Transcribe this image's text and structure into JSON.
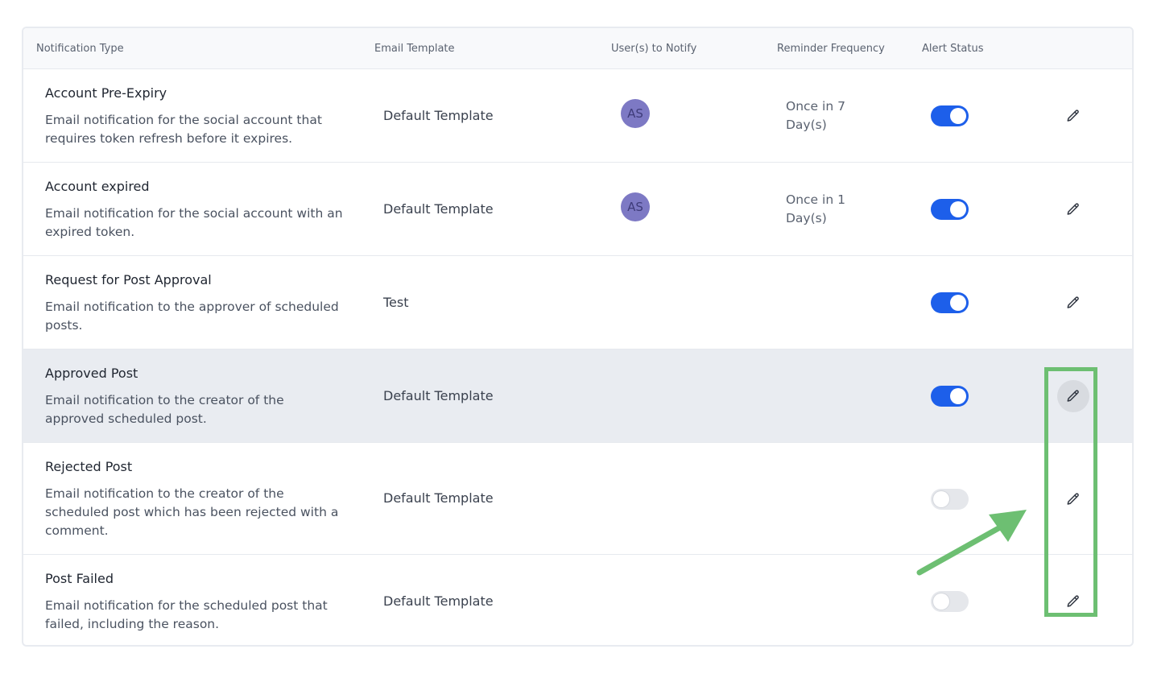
{
  "header": {
    "notification_type": "Notification Type",
    "email_template": "Email Template",
    "users_to_notify": "User(s) to Notify",
    "reminder_frequency": "Reminder Frequency",
    "alert_status": "Alert Status"
  },
  "rows": [
    {
      "title": "Account Pre-Expiry",
      "description": "Email notification for the social account that requires token refresh before it expires.",
      "template": "Default Template",
      "user_initials": "AS",
      "frequency": "Once in 7 Day(s)",
      "alert_on": true
    },
    {
      "title": "Account expired",
      "description": "Email notification for the social account with an expired token.",
      "template": "Default Template",
      "user_initials": "AS",
      "frequency": "Once in 1 Day(s)",
      "alert_on": true
    },
    {
      "title": "Request for Post Approval",
      "description": "Email notification to the approver of scheduled posts.",
      "template": "Test",
      "user_initials": "",
      "frequency": "",
      "alert_on": true
    },
    {
      "title": "Approved Post",
      "description": "Email notification to the creator of the approved scheduled post.",
      "template": "Default Template",
      "user_initials": "",
      "frequency": "",
      "alert_on": true
    },
    {
      "title": "Rejected Post",
      "description": "Email notification to the creator of the scheduled post which has been rejected with a comment.",
      "template": "Default Template",
      "user_initials": "",
      "frequency": "",
      "alert_on": false
    },
    {
      "title": "Post Failed",
      "description": "Email notification for the scheduled post that failed, including the reason.",
      "template": "Default Template",
      "user_initials": "",
      "frequency": "",
      "alert_on": false
    }
  ],
  "colors": {
    "toggle_on": "#1d5fea",
    "toggle_off": "#e5e7eb",
    "avatar": "#7d79c4",
    "highlight_row": "#e9ecf1",
    "annotation": "#6dbf72"
  },
  "icons": {
    "edit": "pencil-icon"
  }
}
